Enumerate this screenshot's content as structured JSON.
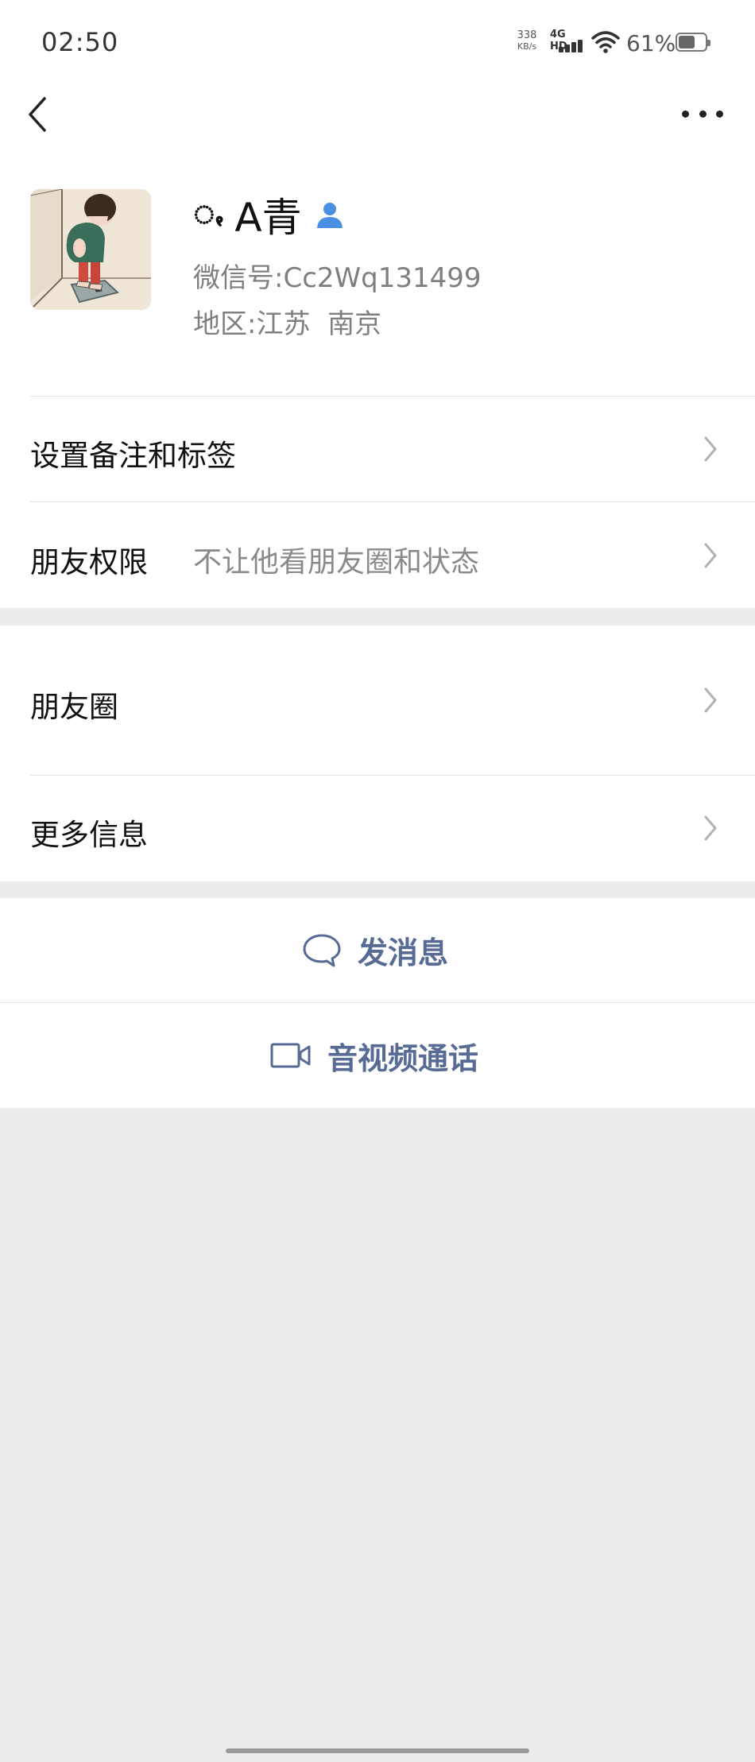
{
  "status_bar": {
    "time": "02:50",
    "net_speed_value": "338",
    "net_speed_unit": "KB/s",
    "network_label": "4G HD",
    "battery_percent": "61%",
    "battery_level": 0.61
  },
  "profile": {
    "name_symbol": "ꩻ",
    "name": "A青",
    "wechat_id_label": "微信号:",
    "wechat_id": "Cc2Wq131499",
    "region_label": "地区:",
    "region_value": "江苏  南京"
  },
  "rows": {
    "remark_tags": "设置备注和标签",
    "friend_permissions_label": "朋友权限",
    "friend_permissions_value": "不让他看朋友圈和状态",
    "moments": "朋友圈",
    "more_info": "更多信息"
  },
  "actions": {
    "send_message": "发消息",
    "av_call": "音视频通话"
  },
  "colors": {
    "link_blue": "#576b95",
    "background_gray": "#ededed",
    "contact_icon_blue": "#4a90e2"
  }
}
